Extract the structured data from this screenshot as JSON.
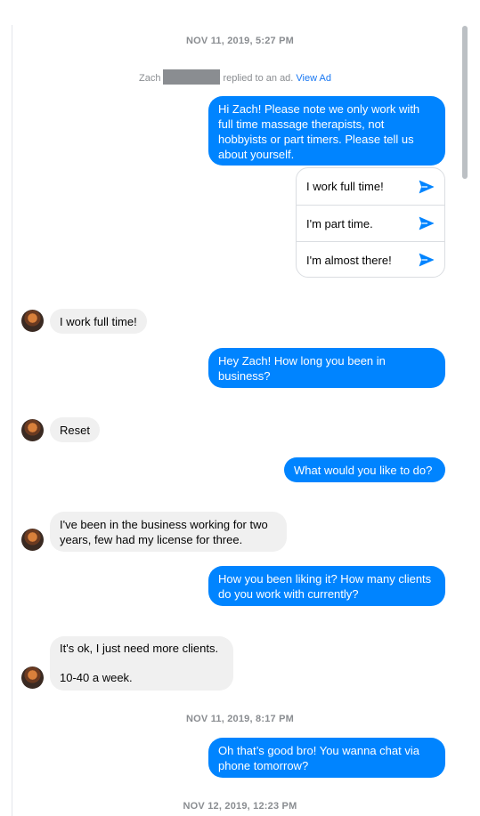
{
  "timestamps": {
    "t1": "NOV 11, 2019, 5:27 PM",
    "t2": "NOV 11, 2019, 8:17 PM",
    "t3": "NOV 12, 2019, 12:23 PM"
  },
  "ad_notice": {
    "name": "Zach",
    "text": "replied to an ad.",
    "link": "View Ad"
  },
  "messages": {
    "m1": "Hi Zach! Please note we only work with full time massage therapists, not hobbyists or part timers. Please tell us about yourself.",
    "m2": "I work full time!",
    "m3": "Hey Zach! How long you been in business?",
    "m4": "Reset",
    "m5": "What would you like to do?",
    "m6": "I've been in the business working for two years, few had my license for three.",
    "m7": "How you been liking it? How many clients do you work with currently?",
    "m8a": "It's ok, I just need more clients.",
    "m8b": "10-40 a week.",
    "m9": "Oh that’s good bro! You wanna chat via phone tomorrow?"
  },
  "quick_replies": [
    {
      "label": "I work full time!",
      "icon": "send-icon"
    },
    {
      "label": "I'm part time.",
      "icon": "send-icon"
    },
    {
      "label": "I'm almost there!",
      "icon": "send-icon"
    }
  ],
  "colors": {
    "outgoing": "#0084ff",
    "incoming": "#f0f0f0",
    "accent": "#1877f2",
    "timestamp": "#8a8d91"
  }
}
